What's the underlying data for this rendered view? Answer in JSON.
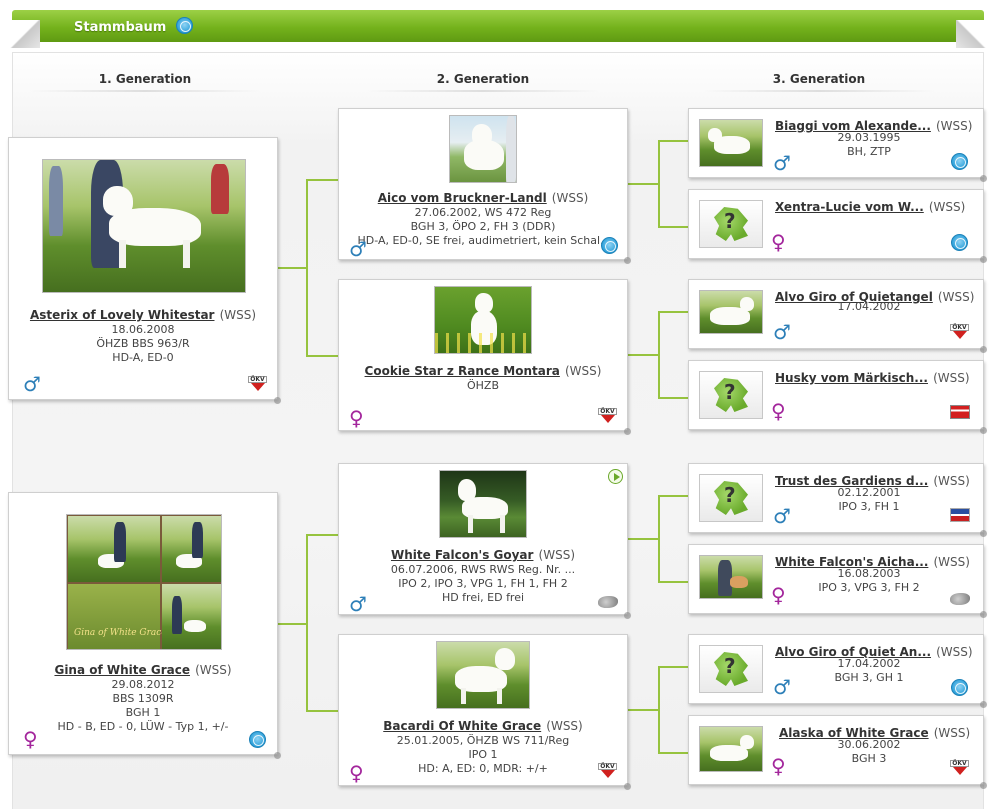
{
  "header": {
    "title": "Stammbaum",
    "badge_icon": "fci-icon"
  },
  "generations": [
    "1. Generation",
    "2. Generation",
    "3. Generation"
  ],
  "colors": {
    "accent": "#7ab51f",
    "male": "#2d7fb8",
    "female": "#a3269c"
  },
  "gen1": [
    {
      "name": "Asterix of Lovely Whitestar",
      "breed": "(WSS)",
      "lines": [
        "18.06.2008",
        "ÖHZB BBS 963/R",
        "HD-A, ED-0"
      ],
      "sex": "♂",
      "club_icon": "okv-icon"
    },
    {
      "name": "Gina of White Grace",
      "breed": "(WSS)",
      "lines": [
        "29.08.2012",
        "BBS 1309R",
        "BGH 1",
        "HD - B, ED - 0, LÜW - Typ 1, +/-"
      ],
      "sex": "♀",
      "club_icon": "fci-icon",
      "photo_caption": "Gina of White Grace"
    }
  ],
  "gen2": [
    {
      "name": "Aico vom Bruckner-Landl",
      "breed": "(WSS)",
      "lines": [
        "27.06.2002, WS 472 Reg",
        "BGH 3, ÖPO 2, FH 3 (DDR)",
        "HD-A, ED-0, SE frei, audimetriert, kein Schal..."
      ],
      "sex": "♂",
      "club_icon": "fci-icon"
    },
    {
      "name": "Cookie Star z Rance Montara",
      "breed": "(WSS)",
      "lines": [
        "ÖHZB"
      ],
      "sex": "♀",
      "club_icon": "okv-icon"
    },
    {
      "name": "White Falcon's Goyar",
      "breed": "(WSS)",
      "lines": [
        "06.07.2006, RWS RWS Reg. Nr. ...",
        "IPO 2, IPO 3, VPG 1, FH 1, FH 2",
        "HD frei, ED frei"
      ],
      "sex": "♂",
      "club_icon": "club-icon",
      "video_icon": "video-play-icon"
    },
    {
      "name": "Bacardi Of White Grace",
      "breed": "(WSS)",
      "lines": [
        "25.01.2005, ÖHZB WS 711/Reg",
        "IPO 1",
        "HD: A, ED: 0, MDR: +/+"
      ],
      "sex": "♀",
      "club_icon": "okv-icon"
    }
  ],
  "gen3": [
    {
      "name": "Biaggi vom Alexande...",
      "breed": "(WSS)",
      "lines": [
        "29.03.1995",
        "BH, ZTP"
      ],
      "sex": "♂",
      "club_icon": "fci-icon",
      "photo": true
    },
    {
      "name": "Xentra-Lucie vom W...",
      "breed": "(WSS)",
      "lines": [],
      "sex": "♀",
      "club_icon": "fci-icon",
      "photo": false
    },
    {
      "name": "Alvo Giro of Quietangel",
      "breed": "(WSS)",
      "lines": [
        "17.04.2002"
      ],
      "sex": "♂",
      "club_icon": "okv-icon",
      "photo": true
    },
    {
      "name": "Husky vom Märkisch...",
      "breed": "(WSS)",
      "lines": [],
      "sex": "♀",
      "club_icon": "flag-icon",
      "photo": false
    },
    {
      "name": "Trust des Gardiens d...",
      "breed": "(WSS)",
      "lines": [
        "02.12.2001",
        "IPO 3, FH 1"
      ],
      "sex": "♂",
      "club_icon": "flag-icon",
      "photo": false
    },
    {
      "name": "White Falcon's Aicha...",
      "breed": "(WSS)",
      "lines": [
        "16.08.2003",
        "IPO 3, VPG 3, FH 2"
      ],
      "sex": "♀",
      "club_icon": "club-icon",
      "photo": true
    },
    {
      "name": "Alvo Giro of Quiet An...",
      "breed": "(WSS)",
      "lines": [
        "17.04.2002",
        "BGH 3, GH 1"
      ],
      "sex": "♂",
      "club_icon": "fci-icon",
      "photo": false
    },
    {
      "name": "Alaska of White Grace",
      "breed": "(WSS)",
      "lines": [
        "30.06.2002",
        "BGH 3"
      ],
      "sex": "♀",
      "club_icon": "okv-icon",
      "photo": true
    }
  ]
}
